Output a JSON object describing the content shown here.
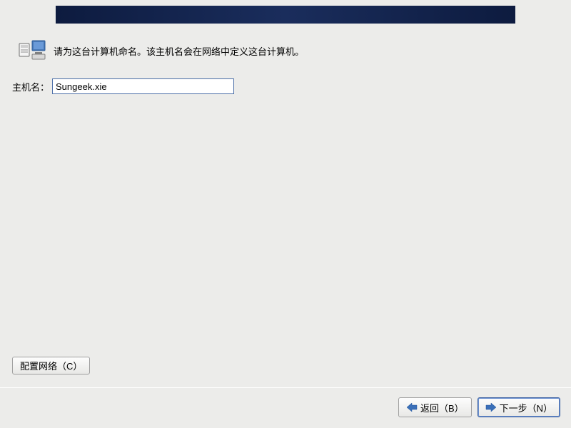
{
  "description": "请为这台计算机命名。该主机名会在网络中定义这台计算机。",
  "hostname": {
    "label": "主机名：",
    "value": "Sungeek.xie"
  },
  "buttons": {
    "configure_network": "配置网络（C）",
    "back": "返回（B）",
    "next": "下一步（N）"
  }
}
